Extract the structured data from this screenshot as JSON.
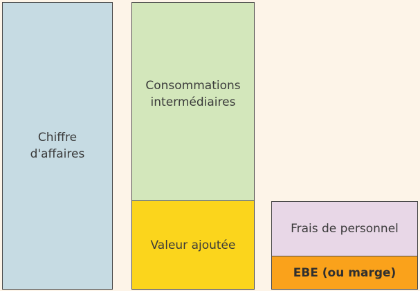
{
  "blocks": {
    "chiffre_affaires": "Chiffre\nd'affaires",
    "consommations": "Consommations\nintermédiaires",
    "valeur_ajoutee": "Valeur ajoutée",
    "frais_personnel": "Frais de personnel",
    "ebe": "EBE (ou marge)"
  },
  "colors": {
    "background": "#fdf4e8",
    "chiffre_affaires": "#c6dbe3",
    "consommations": "#d3e7bb",
    "valeur_ajoutee": "#fbd51c",
    "frais_personnel": "#e8d7e7",
    "ebe": "#faa21b"
  }
}
